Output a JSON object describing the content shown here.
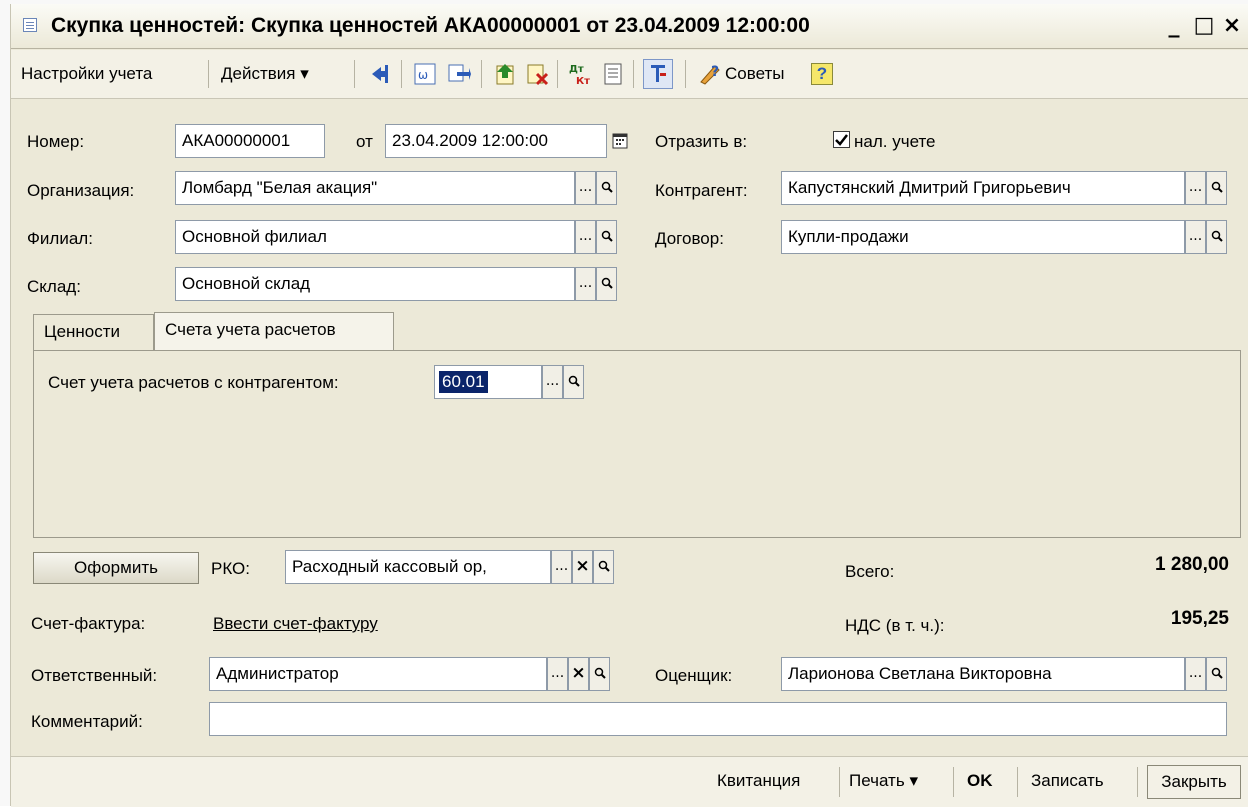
{
  "window": {
    "title": "Скупка ценностей: Скупка ценностей АКА00000001 от 23.04.2009 12:00:00",
    "minimize": "_",
    "maximize": "□",
    "close": "×"
  },
  "toolbar": {
    "settings_label": "Настройки учета",
    "actions_label": "Действия",
    "actions_arrow": "▾",
    "tips_label": "Советы",
    "help_label": "?",
    "dtkt_top": "Дт",
    "dtkt_bottom": "Кт",
    "icons": [
      "arrow-left-icon",
      "refresh-icon",
      "swap-icon",
      "document-up-icon",
      "document-delete-icon",
      "dtkt-icon",
      "list-icon",
      "structure-icon",
      "tips-icon",
      "help-icon"
    ]
  },
  "form": {
    "number_label": "Номер:",
    "number_value": "АКА00000001",
    "date_prefix": "от",
    "date_value": "23.04.2009 12:00:00",
    "reflect_label": "Отразить в:",
    "tax_accounting_label": "нал. учете",
    "tax_accounting_checked": true,
    "organization_label": "Организация:",
    "organization_value": "Ломбард \"Белая акация\"",
    "counterparty_label": "Контрагент:",
    "counterparty_value": "Капустянский Дмитрий Григорьевич",
    "branch_label": "Филиал:",
    "branch_value": "Основной филиал",
    "contract_label": "Договор:",
    "contract_value": "Купли-продажи",
    "warehouse_label": "Склад:",
    "warehouse_value": "Основной склад",
    "select_glyph": "...",
    "clear_glyph": "×"
  },
  "tabs": [
    {
      "label": "Ценности",
      "active": false
    },
    {
      "label": "Счета учета расчетов",
      "active": true
    }
  ],
  "tab_panel": {
    "account_label": "Счет учета расчетов с контрагентом:",
    "account_value": "60.01"
  },
  "footer_form": {
    "process_button": "Оформить",
    "rko_label": "РКО:",
    "rko_value": "Расходный кассовый ор,",
    "total_label": "Всего:",
    "total_value": "1 280,00",
    "invoice_label": "Счет-фактура:",
    "invoice_link": "Ввести счет-фактуру",
    "vat_label": "НДС (в т. ч.):",
    "vat_value": "195,25",
    "responsible_label": "Ответственный:",
    "responsible_value": "Администратор",
    "appraiser_label": "Оценщик:",
    "appraiser_value": "Ларионова Светлана Викторовна",
    "comment_label": "Комментарий:",
    "comment_value": ""
  },
  "bottom_bar": {
    "receipt": "Квитанция",
    "print": "Печать",
    "print_arrow": "▾",
    "ok": "OK",
    "save": "Записать",
    "close": "Закрыть"
  },
  "colors": {
    "window_bg": "#ece9d8",
    "selection": "#0a246a",
    "help_bg": "#f5e76a"
  }
}
